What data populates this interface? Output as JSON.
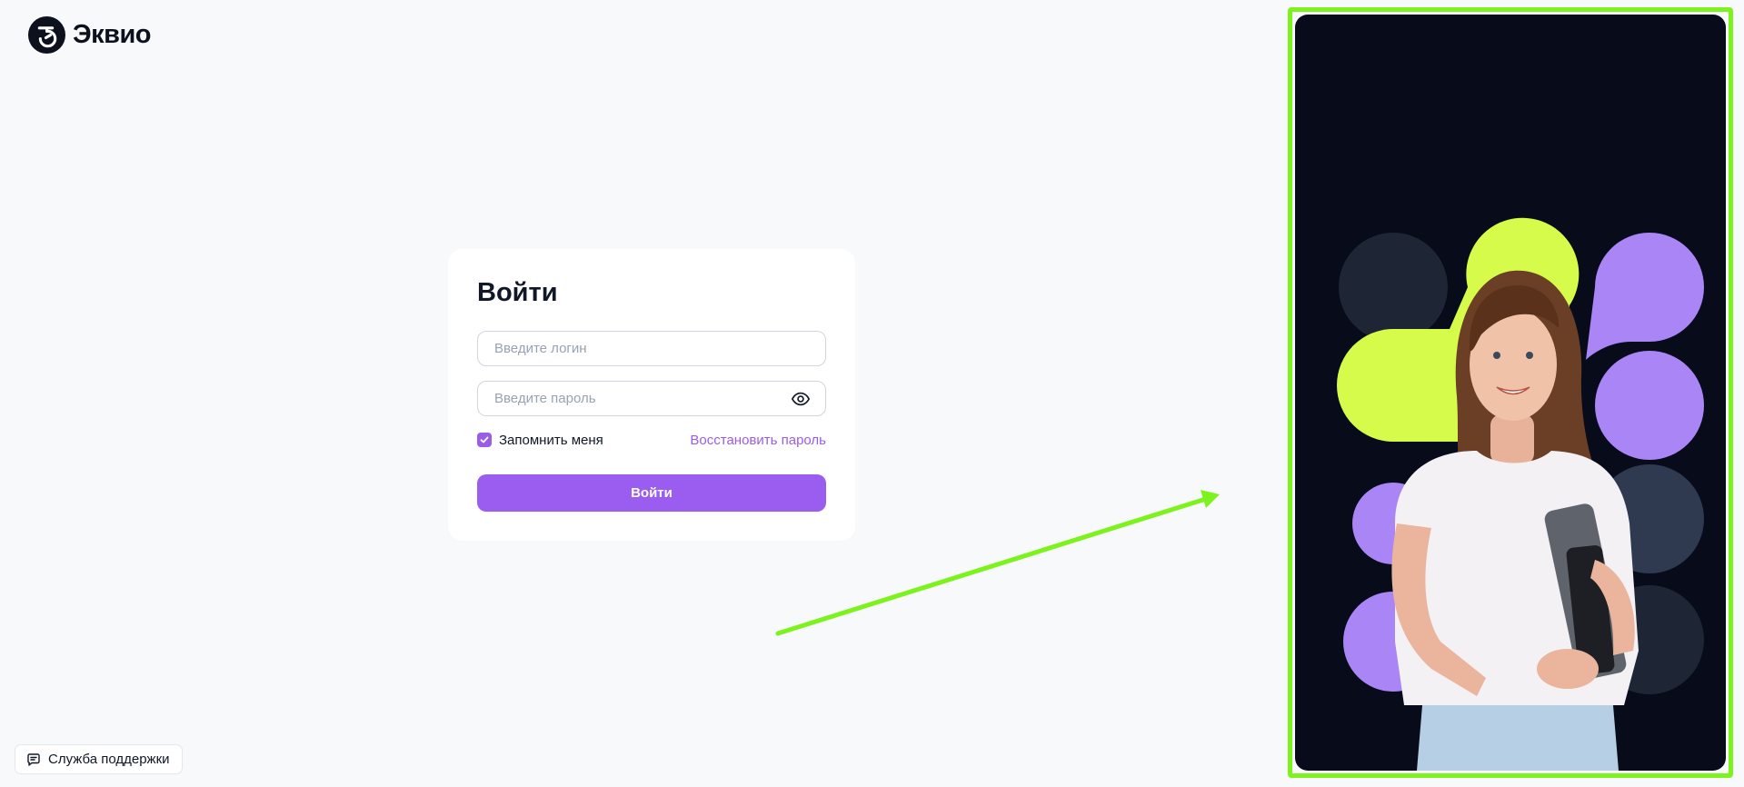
{
  "brand": {
    "name": "Эквио"
  },
  "login": {
    "title": "Войти",
    "login_placeholder": "Введите логин",
    "password_placeholder": "Введите пароль",
    "remember_label": "Запомнить меня",
    "remember_checked": true,
    "restore_label": "Восстановить пароль",
    "submit_label": "Войти"
  },
  "support": {
    "label": "Служба поддержки"
  },
  "icons": {
    "logo": "logo-icon",
    "password_toggle": "eye-icon",
    "checkbox_check": "check-icon",
    "support": "chat-icon"
  },
  "colors": {
    "accent": "#9b5def",
    "background": "#f8f9fb",
    "panel_background": "#070b1a",
    "highlight_green": "#7cf31c",
    "lime_shape": "#d7fb4b",
    "purple_shape": "#a985f5",
    "dark_shape": "#1e2535"
  }
}
